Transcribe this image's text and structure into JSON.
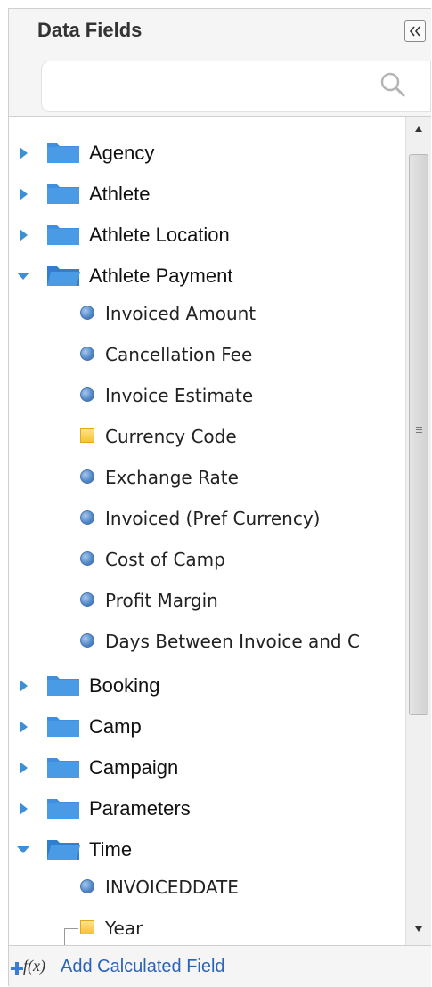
{
  "panel": {
    "title": "Data Fields",
    "search_placeholder": ""
  },
  "tree": {
    "folders_top": [
      {
        "label": "Agency",
        "expanded": false
      },
      {
        "label": "Athlete",
        "expanded": false
      },
      {
        "label": "Athlete Location",
        "expanded": false
      },
      {
        "label": "Athlete Payment",
        "expanded": true
      }
    ],
    "athlete_payment_fields": [
      {
        "label": "Invoiced Amount",
        "kind": "measure"
      },
      {
        "label": "Cancellation Fee",
        "kind": "measure"
      },
      {
        "label": "Invoice Estimate",
        "kind": "measure"
      },
      {
        "label": "Currency Code",
        "kind": "dimension"
      },
      {
        "label": "Exchange Rate",
        "kind": "measure"
      },
      {
        "label": "Invoiced (Pref Currency)",
        "kind": "measure"
      },
      {
        "label": "Cost of Camp",
        "kind": "measure"
      },
      {
        "label": "Profit Margin",
        "kind": "measure"
      },
      {
        "label": "Days Between Invoice and C",
        "kind": "measure"
      }
    ],
    "folders_bottom": [
      {
        "label": "Booking",
        "expanded": false
      },
      {
        "label": "Camp",
        "expanded": false
      },
      {
        "label": "Campaign",
        "expanded": false
      },
      {
        "label": "Parameters",
        "expanded": false
      },
      {
        "label": "Time",
        "expanded": true
      }
    ],
    "time_fields": [
      {
        "label": "INVOICEDDATE",
        "kind": "measure"
      },
      {
        "label": "Year",
        "kind": "dimension"
      }
    ]
  },
  "footer": {
    "fx_label": "f(x)",
    "add_calculated_label": "Add Calculated Field"
  },
  "colors": {
    "folder_blue": "#3f8fde",
    "arrow_blue": "#3d8fd6",
    "link_blue": "#2a63b8",
    "measure_dot": "#4f86c6",
    "dimension_square": "#f5c430"
  },
  "icons": {
    "collapse": "double-chevron-left-icon",
    "search": "magnifier-icon",
    "folder": "folder-icon",
    "measure": "circle-icon",
    "dimension": "square-icon",
    "add": "plus-icon"
  }
}
